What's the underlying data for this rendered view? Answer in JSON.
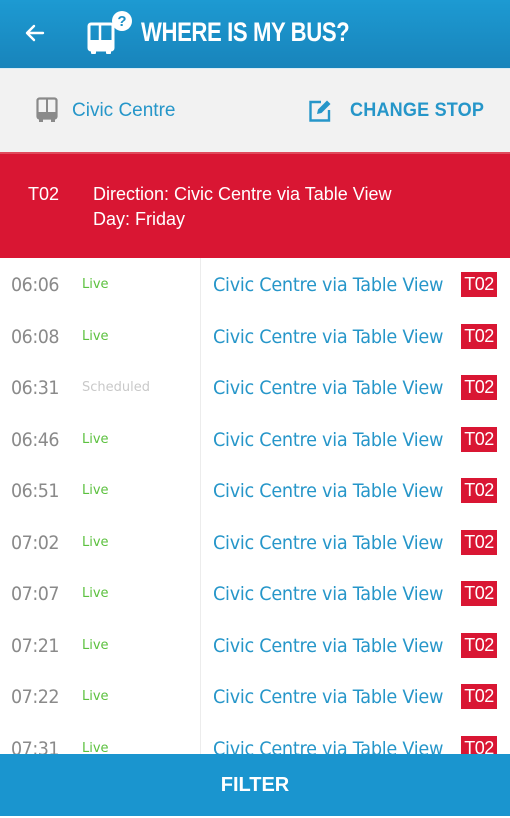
{
  "header": {
    "title": "WHERE IS MY BUS?",
    "back_icon": "arrow-left-icon",
    "logo_icon": "bus-question-icon"
  },
  "stop": {
    "icon": "bus-icon",
    "name": "Civic Centre",
    "change_icon": "edit-icon",
    "change_label": "CHANGE STOP"
  },
  "route": {
    "code": "T02",
    "direction": "Direction: Civic Centre via Table View",
    "day": "Day: Friday"
  },
  "colors": {
    "primary": "#1a95cf",
    "accent_red": "#d91633",
    "live_green": "#5cc13f",
    "scheduled_gray": "#c9c9c9",
    "link_blue": "#2696c9"
  },
  "departures": [
    {
      "time": "06:06",
      "status": "Live",
      "status_type": "live",
      "destination": "Civic Centre via Table View",
      "route": "T02"
    },
    {
      "time": "06:08",
      "status": "Live",
      "status_type": "live",
      "destination": "Civic Centre via Table View",
      "route": "T02"
    },
    {
      "time": "06:31",
      "status": "Scheduled",
      "status_type": "scheduled",
      "destination": "Civic Centre via Table View",
      "route": "T02"
    },
    {
      "time": "06:46",
      "status": "Live",
      "status_type": "live",
      "destination": "Civic Centre via Table View",
      "route": "T02"
    },
    {
      "time": "06:51",
      "status": "Live",
      "status_type": "live",
      "destination": "Civic Centre via Table View",
      "route": "T02"
    },
    {
      "time": "07:02",
      "status": "Live",
      "status_type": "live",
      "destination": "Civic Centre via Table View",
      "route": "T02"
    },
    {
      "time": "07:07",
      "status": "Live",
      "status_type": "live",
      "destination": "Civic Centre via Table View",
      "route": "T02"
    },
    {
      "time": "07:21",
      "status": "Live",
      "status_type": "live",
      "destination": "Civic Centre via Table View",
      "route": "T02"
    },
    {
      "time": "07:22",
      "status": "Live",
      "status_type": "live",
      "destination": "Civic Centre via Table View",
      "route": "T02"
    },
    {
      "time": "07:31",
      "status": "Live",
      "status_type": "live",
      "destination": "Civic Centre via Table View",
      "route": "T02"
    }
  ],
  "footer": {
    "filter_label": "FILTER"
  }
}
